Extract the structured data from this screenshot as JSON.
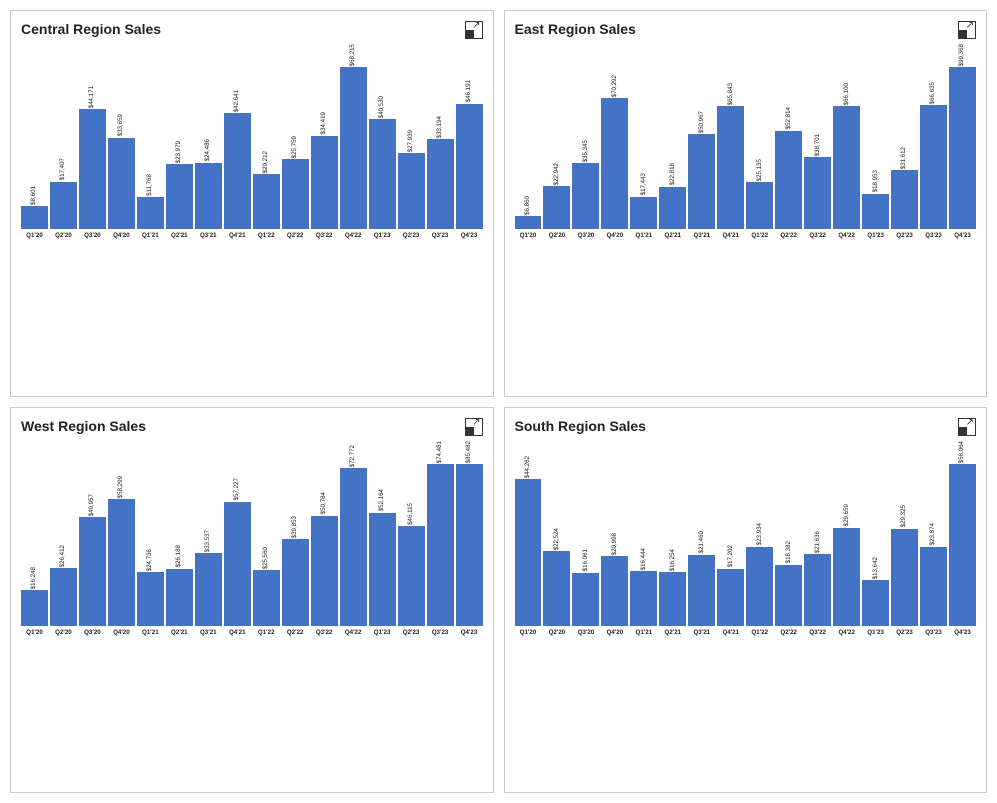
{
  "charts": [
    {
      "id": "central",
      "title": "Central Region Sales",
      "bars": [
        {
          "label": "Q1'20",
          "value": 8601,
          "display": "$8,601"
        },
        {
          "label": "Q2'20",
          "value": 17407,
          "display": "$17,407"
        },
        {
          "label": "Q3'20",
          "value": 44171,
          "display": "$44,171"
        },
        {
          "label": "Q4'20",
          "value": 33659,
          "display": "$33,659"
        },
        {
          "label": "Q1'21",
          "value": 11768,
          "display": "$11,768"
        },
        {
          "label": "Q2'21",
          "value": 23979,
          "display": "$23,979"
        },
        {
          "label": "Q3'21",
          "value": 24486,
          "display": "$24,486"
        },
        {
          "label": "Q4'21",
          "value": 42641,
          "display": "$42,641"
        },
        {
          "label": "Q1'22",
          "value": 20212,
          "display": "$20,212"
        },
        {
          "label": "Q2'22",
          "value": 25759,
          "display": "$25,759"
        },
        {
          "label": "Q3'22",
          "value": 34419,
          "display": "$34,419"
        },
        {
          "label": "Q4'22",
          "value": 68215,
          "display": "$68,215"
        },
        {
          "label": "Q1'23",
          "value": 40530,
          "display": "$40,530"
        },
        {
          "label": "Q2'23",
          "value": 27939,
          "display": "$27,939"
        },
        {
          "label": "Q3'23",
          "value": 33194,
          "display": "$33,194"
        },
        {
          "label": "Q4'23",
          "value": 46191,
          "display": "$46,191"
        }
      ],
      "max": 68215
    },
    {
      "id": "east",
      "title": "East Region Sales",
      "bars": [
        {
          "label": "Q1'20",
          "value": 6860,
          "display": "$6,860"
        },
        {
          "label": "Q2'20",
          "value": 22942,
          "display": "$22,942"
        },
        {
          "label": "Q3'20",
          "value": 35345,
          "display": "$35,345"
        },
        {
          "label": "Q4'20",
          "value": 70292,
          "display": "$70,292"
        },
        {
          "label": "Q1'21",
          "value": 17443,
          "display": "$17,443"
        },
        {
          "label": "Q2'21",
          "value": 22818,
          "display": "$22,818"
        },
        {
          "label": "Q3'21",
          "value": 50967,
          "display": "$50,967"
        },
        {
          "label": "Q4'21",
          "value": 65843,
          "display": "$65,843"
        },
        {
          "label": "Q1'22",
          "value": 25135,
          "display": "$25,135"
        },
        {
          "label": "Q2'22",
          "value": 52814,
          "display": "$52,814"
        },
        {
          "label": "Q3'22",
          "value": 38701,
          "display": "$38,701"
        },
        {
          "label": "Q4'22",
          "value": 66100,
          "display": "$66,100"
        },
        {
          "label": "Q1'23",
          "value": 18953,
          "display": "$18,953"
        },
        {
          "label": "Q2'23",
          "value": 31612,
          "display": "$31,612"
        },
        {
          "label": "Q3'23",
          "value": 66635,
          "display": "$66,635"
        },
        {
          "label": "Q4'23",
          "value": 99368,
          "display": "$99,368"
        }
      ],
      "max": 99368
    },
    {
      "id": "west",
      "title": "West Region Sales",
      "bars": [
        {
          "label": "Q1'20",
          "value": 16248,
          "display": "$16,248"
        },
        {
          "label": "Q2'20",
          "value": 26412,
          "display": "$26,412"
        },
        {
          "label": "Q3'20",
          "value": 49957,
          "display": "$49,957"
        },
        {
          "label": "Q4'20",
          "value": 58299,
          "display": "$58,299"
        },
        {
          "label": "Q1'21",
          "value": 24736,
          "display": "$24,736"
        },
        {
          "label": "Q2'21",
          "value": 26188,
          "display": "$26,188"
        },
        {
          "label": "Q3'21",
          "value": 33537,
          "display": "$33,537"
        },
        {
          "label": "Q4'21",
          "value": 57227,
          "display": "$57,227"
        },
        {
          "label": "Q1'22",
          "value": 25560,
          "display": "$25,560"
        },
        {
          "label": "Q2'22",
          "value": 39853,
          "display": "$39,853"
        },
        {
          "label": "Q3'22",
          "value": 50784,
          "display": "$50,784"
        },
        {
          "label": "Q4'22",
          "value": 72772,
          "display": "$72,772"
        },
        {
          "label": "Q1'23",
          "value": 52164,
          "display": "$52,164"
        },
        {
          "label": "Q2'23",
          "value": 46115,
          "display": "$46,115"
        },
        {
          "label": "Q3'23",
          "value": 74481,
          "display": "$74,481"
        },
        {
          "label": "Q4'23",
          "value": 85482,
          "display": "$85,482"
        }
      ],
      "max": 85482
    },
    {
      "id": "south",
      "title": "South Region Sales",
      "bars": [
        {
          "label": "Q1'20",
          "value": 44262,
          "display": "$44,262"
        },
        {
          "label": "Q2'20",
          "value": 22524,
          "display": "$22,524"
        },
        {
          "label": "Q3'20",
          "value": 16061,
          "display": "$16,061"
        },
        {
          "label": "Q4'20",
          "value": 20998,
          "display": "$20,998"
        },
        {
          "label": "Q1'21",
          "value": 16444,
          "display": "$16,444"
        },
        {
          "label": "Q2'21",
          "value": 16254,
          "display": "$16,254"
        },
        {
          "label": "Q3'21",
          "value": 21460,
          "display": "$21,460"
        },
        {
          "label": "Q4'21",
          "value": 17202,
          "display": "$17,202"
        },
        {
          "label": "Q1'22",
          "value": 23934,
          "display": "$23,934"
        },
        {
          "label": "Q2'22",
          "value": 18382,
          "display": "$18,382"
        },
        {
          "label": "Q3'22",
          "value": 21636,
          "display": "$21,636"
        },
        {
          "label": "Q4'22",
          "value": 29659,
          "display": "$29,659"
        },
        {
          "label": "Q1'23",
          "value": 13642,
          "display": "$13,642"
        },
        {
          "label": "Q2'23",
          "value": 29325,
          "display": "$29,325"
        },
        {
          "label": "Q3'23",
          "value": 23874,
          "display": "$23,874"
        },
        {
          "label": "Q4'23",
          "value": 56064,
          "display": "$56,064"
        }
      ],
      "max": 56064
    }
  ],
  "expand_label": "Expand",
  "bar_color": "#4472C4"
}
